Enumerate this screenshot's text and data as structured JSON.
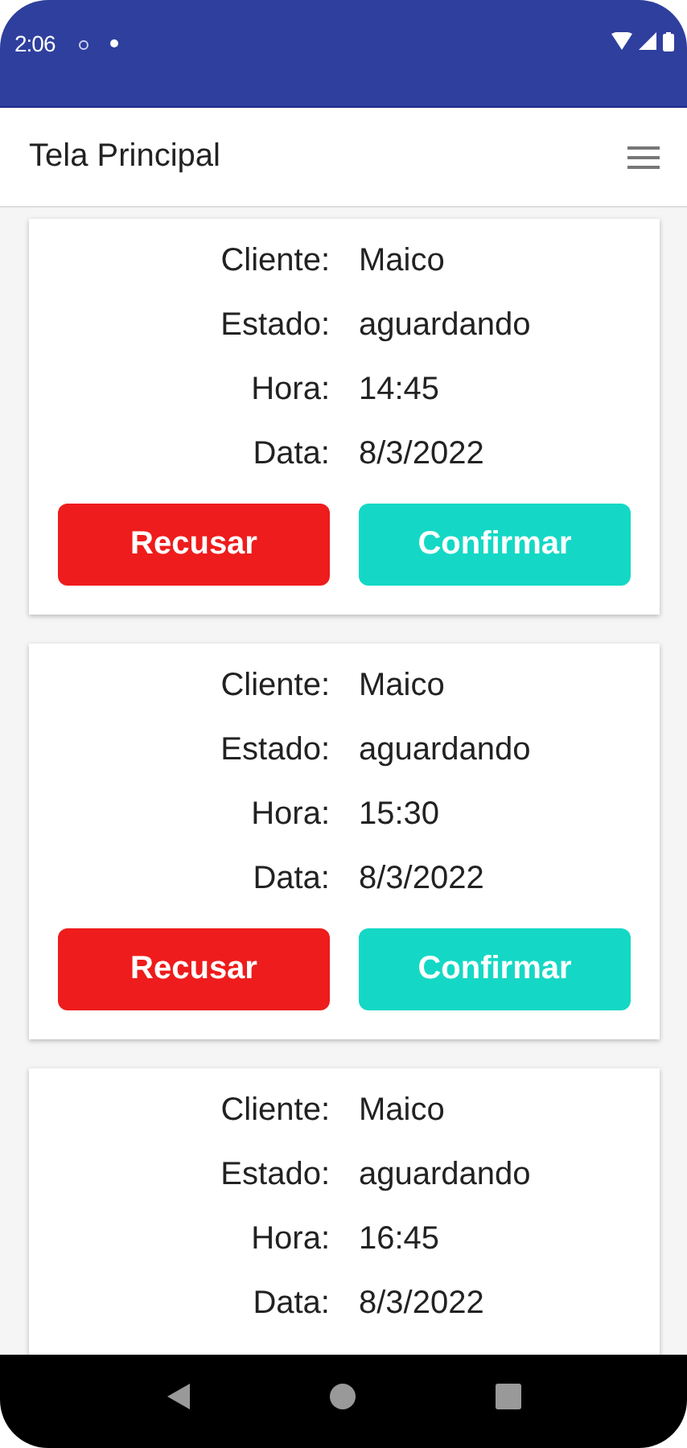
{
  "status_bar": {
    "time": "2:06"
  },
  "app_bar": {
    "title": "Tela Principal"
  },
  "cards": [
    {
      "fields": [
        {
          "label": "Cliente:",
          "value": "Maico"
        },
        {
          "label": "Estado:",
          "value": "aguardando"
        },
        {
          "label": "Hora:",
          "value": "14:45"
        },
        {
          "label": "Data:",
          "value": "8/3/2022"
        }
      ],
      "buttons": [
        {
          "label": "Recusar",
          "kind": "reject"
        },
        {
          "label": "Confirmar",
          "kind": "confirm"
        }
      ]
    },
    {
      "fields": [
        {
          "label": "Cliente:",
          "value": "Maico"
        },
        {
          "label": "Estado:",
          "value": "aguardando"
        },
        {
          "label": "Hora:",
          "value": "15:30"
        },
        {
          "label": "Data:",
          "value": "8/3/2022"
        }
      ],
      "buttons": [
        {
          "label": "Recusar",
          "kind": "reject"
        },
        {
          "label": "Confirmar",
          "kind": "confirm"
        }
      ]
    },
    {
      "fields": [
        {
          "label": "Cliente:",
          "value": "Maico"
        },
        {
          "label": "Estado:",
          "value": "aguardando"
        },
        {
          "label": "Hora:",
          "value": "16:45"
        },
        {
          "label": "Data:",
          "value": "8/3/2022"
        }
      ]
    }
  ]
}
